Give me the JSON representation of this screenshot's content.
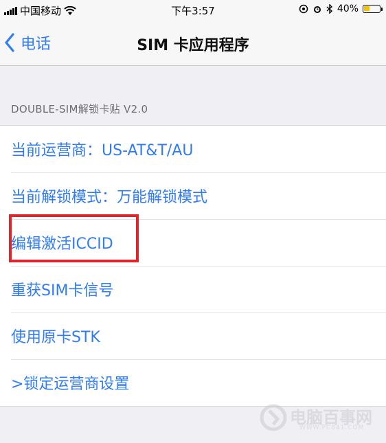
{
  "status_bar": {
    "carrier": "中国移动",
    "wifi_icon": "wifi-icon",
    "time": "下午3:57",
    "battery_percent": "40%",
    "battery_level": 0.4,
    "battery_color": "#f5c400"
  },
  "nav": {
    "back_label": "电话",
    "title": "SIM 卡应用程序"
  },
  "section": {
    "header": "DOUBLE-SIM解锁卡贴 V2.0"
  },
  "items": [
    {
      "label": "当前运营商：US-AT&T/AU"
    },
    {
      "label": "当前解锁模式：万能解锁模式"
    },
    {
      "label": "编辑激活ICCID"
    },
    {
      "label": "重获SIM卡信号"
    },
    {
      "label": "使用原卡STK"
    },
    {
      "label": ">锁定运营商设置"
    }
  ],
  "watermark": {
    "text": "电脑百事网",
    "url": "WWW.PC841.COM"
  },
  "colors": {
    "accent": "#2f7cf6",
    "highlight": "#e0242a",
    "background": "#efeff4"
  }
}
